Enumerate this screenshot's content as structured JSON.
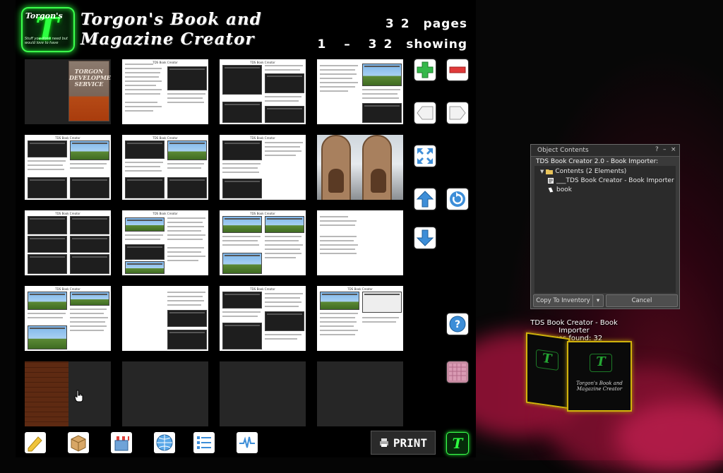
{
  "hud": {
    "logo_letter": "T",
    "logo_name": "Torgon's",
    "logo_tagline": "Stuff you don't need but would love to have",
    "title_line1": "Torgon's Book and",
    "title_line2": "Magazine Creator",
    "pages_count": "32",
    "pages_label": "pages",
    "showing_range": "1 – 32",
    "showing_label": "showing",
    "cover_text": "TORGON DEVELOPMENT SERVICE",
    "page_header": "TDS Book Creator",
    "print_label": "PRINT"
  },
  "side_buttons": [
    {
      "name": "add-page-button",
      "icon": "plus-icon"
    },
    {
      "name": "remove-page-button",
      "icon": "minus-icon"
    },
    {
      "name": "previous-page-button",
      "icon": "arrow-left-icon"
    },
    {
      "name": "next-page-button",
      "icon": "arrow-right-icon"
    },
    {
      "name": "expand-button",
      "icon": "expand-arrows-icon"
    },
    {
      "name": "move-up-button",
      "icon": "arrow-up-icon"
    },
    {
      "name": "refresh-button",
      "icon": "refresh-icon"
    },
    {
      "name": "move-down-button",
      "icon": "arrow-down-icon"
    },
    {
      "name": "help-button",
      "icon": "question-icon"
    },
    {
      "name": "texture-button",
      "icon": "texture-icon"
    }
  ],
  "toolbar": [
    {
      "name": "note-button",
      "icon": "pencil-icon"
    },
    {
      "name": "box-button",
      "icon": "box-icon"
    },
    {
      "name": "store-button",
      "icon": "store-icon"
    },
    {
      "name": "web-button",
      "icon": "globe-icon"
    },
    {
      "name": "list-button",
      "icon": "list-icon"
    },
    {
      "name": "activity-button",
      "icon": "pulse-icon"
    }
  ],
  "dialog": {
    "title": "Object Contents",
    "help": "?",
    "minimize": "–",
    "close": "×",
    "object_name": "TDS Book Creator 2.0 - Book Importer:",
    "folder_label": "Contents (2 Elements)",
    "items": [
      "___TDS Book Creator - Book Importer",
      "book"
    ],
    "copy_button": "Copy To Inventory",
    "cancel_button": "Cancel"
  },
  "floating": {
    "line1": "TDS Book Creator - Book Importer",
    "line2": "Pages found: 32"
  },
  "cube_text": "Torgon's Book and Magazine Creator"
}
